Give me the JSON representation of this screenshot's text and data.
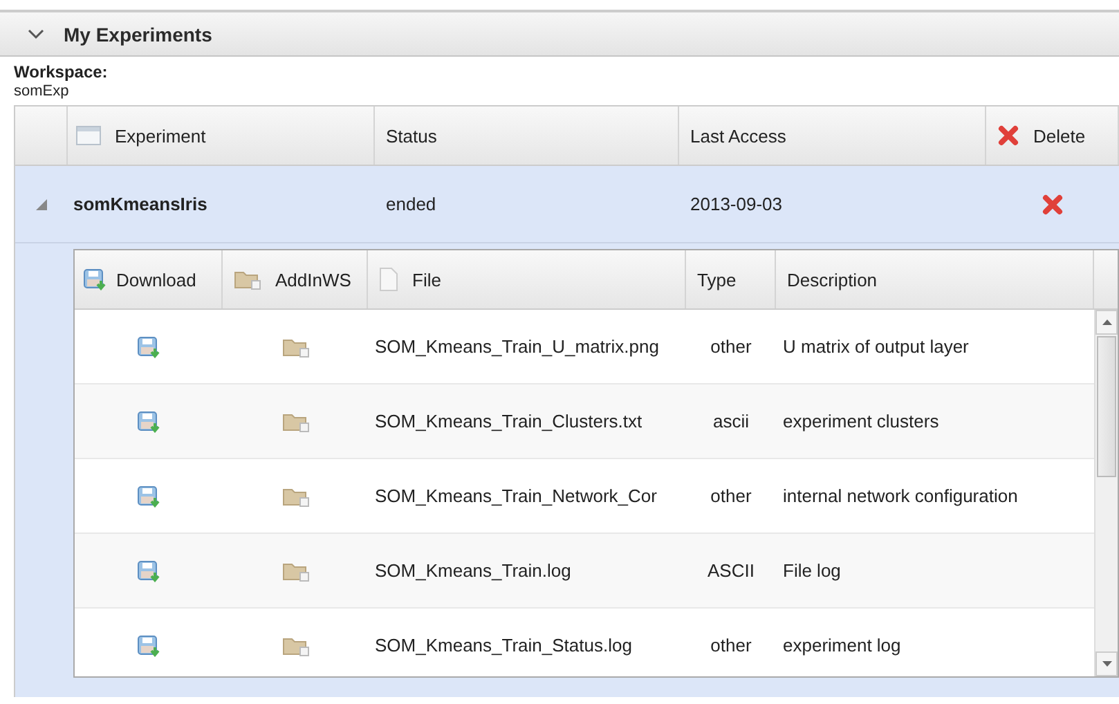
{
  "panel": {
    "title": "My Experiments",
    "expanded": true
  },
  "workspace": {
    "label": "Workspace:",
    "value": "somExp"
  },
  "table": {
    "columns": [
      "Experiment",
      "Status",
      "Last Access",
      "Delete"
    ],
    "rows": [
      {
        "experiment": "somKmeansIris",
        "status": "ended",
        "last_access": "2013-09-03",
        "expanded": true,
        "files": {
          "columns": [
            "Download",
            "AddInWS",
            "File",
            "Type",
            "Description"
          ],
          "rows": [
            {
              "file": "SOM_Kmeans_Train_U_matrix.png",
              "type": "other",
              "description": "U matrix of output layer"
            },
            {
              "file": "SOM_Kmeans_Train_Clusters.txt",
              "type": "ascii",
              "description": "experiment clusters"
            },
            {
              "file": "SOM_Kmeans_Train_Network_Cor",
              "type": "other",
              "description": "internal network configuration"
            },
            {
              "file": "SOM_Kmeans_Train.log",
              "type": "ASCII",
              "description": "File log"
            },
            {
              "file": "SOM_Kmeans_Train_Status.log",
              "type": "other",
              "description": "experiment log"
            }
          ]
        }
      }
    ]
  }
}
